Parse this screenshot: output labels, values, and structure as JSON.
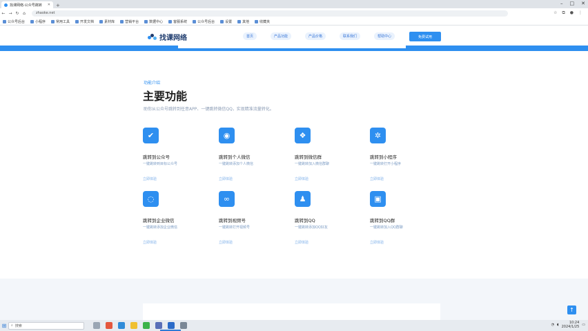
{
  "browser": {
    "tab_title": "找课网络-公众号跳转",
    "new_tab_icon": "plus-icon",
    "address": "zhaoke.net",
    "bookmarks": [
      "公众号后台",
      "小程序",
      "常用工具",
      "开发文档",
      "素材库",
      "营销平台",
      "数据中心",
      "客服系统",
      "公众号后台",
      "设置",
      "其他",
      "收藏夹"
    ]
  },
  "site": {
    "logo_text": "找课网络",
    "nav": [
      "首页",
      "产品功能",
      "产品价格",
      "联系我们",
      "帮助中心"
    ],
    "cta": "免费试用"
  },
  "section": {
    "kicker": "功能介绍",
    "title": "主要功能",
    "subtitle": "助你从公众号跳转到任意APP、一键跳转微信QQ，实现精准流量转化。"
  },
  "features": [
    {
      "name": "跳转到公众号",
      "desc": "一键跳转到目标公众号",
      "link": "立即体验",
      "icon": "check-badge-icon"
    },
    {
      "name": "跳转到个人微信",
      "desc": "一键跳转添加个人微信",
      "link": "立即体验",
      "icon": "wechat-icon"
    },
    {
      "name": "跳转到微信群",
      "desc": "一键跳转加入微信群聊",
      "link": "立即体验",
      "icon": "group-chat-icon"
    },
    {
      "name": "跳转到小程序",
      "desc": "一键跳转打开小程序",
      "link": "立即体验",
      "icon": "miniprogram-icon"
    },
    {
      "name": "跳转到企业微信",
      "desc": "一键跳转添加企业微信",
      "link": "立即体验",
      "icon": "work-wechat-icon"
    },
    {
      "name": "跳转到视频号",
      "desc": "一键跳转打开视频号",
      "link": "立即体验",
      "icon": "channels-icon"
    },
    {
      "name": "跳转到QQ",
      "desc": "一键跳转添加QQ好友",
      "link": "立即体验",
      "icon": "qq-icon"
    },
    {
      "name": "跳转到QQ群",
      "desc": "一键跳转加入QQ群聊",
      "link": "立即体验",
      "icon": "qq-group-icon"
    }
  ],
  "taskbar": {
    "search_placeholder": "搜索",
    "time": "10:24",
    "date": "2024/1/25"
  },
  "colors": {
    "accent": "#2e8ff0",
    "title": "#1f1f1f",
    "muted": "#7c9cc4"
  }
}
